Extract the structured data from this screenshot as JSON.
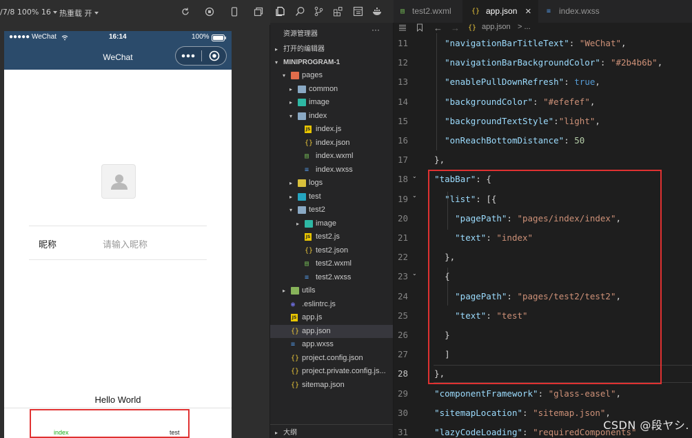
{
  "simulator": {
    "toolbar": {
      "device_info": "/7/8 100% 16",
      "hot_reload": "热重载 开"
    },
    "status_bar": {
      "carrier": "●●●●● WeChat",
      "time": "16:14",
      "battery": "100%"
    },
    "nav_title": "WeChat",
    "page": {
      "nickname_label": "昵称",
      "nickname_placeholder": "请输入昵称",
      "hello_text": "Hello World"
    },
    "tabbar": {
      "tab1": "index",
      "tab2": "test",
      "active_color": "#1aad19"
    }
  },
  "explorer": {
    "title": "资源管理器",
    "more": "···",
    "open_editors": "打开的编辑器",
    "project": "MINIPROGRAM-1",
    "outline": "大纲",
    "tree": [
      {
        "label": "pages",
        "kind": "folder-pages",
        "chev": "▾",
        "indent": 1
      },
      {
        "label": "common",
        "kind": "folder",
        "chev": "▸",
        "indent": 2
      },
      {
        "label": "image",
        "kind": "folder-img",
        "chev": "▸",
        "indent": 2
      },
      {
        "label": "index",
        "kind": "folder",
        "chev": "▾",
        "indent": 2
      },
      {
        "label": "index.js",
        "kind": "js",
        "chev": "",
        "indent": 3
      },
      {
        "label": "index.json",
        "kind": "json",
        "chev": "",
        "indent": 3
      },
      {
        "label": "index.wxml",
        "kind": "wxml",
        "chev": "",
        "indent": 3
      },
      {
        "label": "index.wxss",
        "kind": "wxss",
        "chev": "",
        "indent": 3
      },
      {
        "label": "logs",
        "kind": "folder-yellow",
        "chev": "▸",
        "indent": 2
      },
      {
        "label": "test",
        "kind": "folder-teal",
        "chev": "▸",
        "indent": 2
      },
      {
        "label": "test2",
        "kind": "folder",
        "chev": "▾",
        "indent": 2
      },
      {
        "label": "image",
        "kind": "folder-img",
        "chev": "▸",
        "indent": 3
      },
      {
        "label": "test2.js",
        "kind": "js",
        "chev": "",
        "indent": 3
      },
      {
        "label": "test2.json",
        "kind": "json",
        "chev": "",
        "indent": 3
      },
      {
        "label": "test2.wxml",
        "kind": "wxml",
        "chev": "",
        "indent": 3
      },
      {
        "label": "test2.wxss",
        "kind": "wxss",
        "chev": "",
        "indent": 3
      },
      {
        "label": "utils",
        "kind": "folder-green",
        "chev": "▸",
        "indent": 1
      },
      {
        "label": ".eslintrc.js",
        "kind": "eslint",
        "chev": "",
        "indent": 1
      },
      {
        "label": "app.js",
        "kind": "js",
        "chev": "",
        "indent": 1
      },
      {
        "label": "app.json",
        "kind": "json",
        "chev": "",
        "indent": 1,
        "selected": true
      },
      {
        "label": "app.wxss",
        "kind": "wxss",
        "chev": "",
        "indent": 1
      },
      {
        "label": "project.config.json",
        "kind": "json",
        "chev": "",
        "indent": 1
      },
      {
        "label": "project.private.config.js...",
        "kind": "json",
        "chev": "",
        "indent": 1
      },
      {
        "label": "sitemap.json",
        "kind": "json",
        "chev": "",
        "indent": 1
      }
    ]
  },
  "tabs": [
    {
      "label": "test2.wxml",
      "icon": "wxml",
      "active": false
    },
    {
      "label": "app.json",
      "icon": "json",
      "active": true,
      "close": "×"
    },
    {
      "label": "index.wxss",
      "icon": "wxss",
      "active": false
    }
  ],
  "breadcrumb": {
    "file": "app.json",
    "rest": "> ..."
  },
  "editor": {
    "current_line": 28,
    "lines": [
      {
        "n": 11,
        "t": "    \"navigationBarTitleText\": \"WeChat\","
      },
      {
        "n": 12,
        "t": "    \"navigationBarBackgroundColor\": \"#2b4b6b\","
      },
      {
        "n": 13,
        "t": "    \"enablePullDownRefresh\": true,"
      },
      {
        "n": 14,
        "t": "    \"backgroundColor\": \"#efefef\","
      },
      {
        "n": 15,
        "t": "    \"backgroundTextStyle\":\"light\","
      },
      {
        "n": 16,
        "t": "    \"onReachBottomDistance\": 50"
      },
      {
        "n": 17,
        "t": "  },"
      },
      {
        "n": 18,
        "t": "  \"tabBar\": {"
      },
      {
        "n": 19,
        "t": "    \"list\": [{"
      },
      {
        "n": 20,
        "t": "      \"pagePath\": \"pages/index/index\","
      },
      {
        "n": 21,
        "t": "      \"text\": \"index\""
      },
      {
        "n": 22,
        "t": "    },"
      },
      {
        "n": 23,
        "t": "    {"
      },
      {
        "n": 24,
        "t": "      \"pagePath\": \"pages/test2/test2\","
      },
      {
        "n": 25,
        "t": "      \"text\": \"test\""
      },
      {
        "n": 26,
        "t": "    }"
      },
      {
        "n": 27,
        "t": "    ]"
      },
      {
        "n": 28,
        "t": "  },"
      },
      {
        "n": 29,
        "t": "  \"componentFramework\": \"glass-easel\","
      },
      {
        "n": 30,
        "t": "  \"sitemapLocation\": \"sitemap.json\","
      },
      {
        "n": 31,
        "t": "  \"lazyCodeLoading\": \"requiredComponents\""
      }
    ]
  },
  "watermark": "CSDN @段ヤシ."
}
